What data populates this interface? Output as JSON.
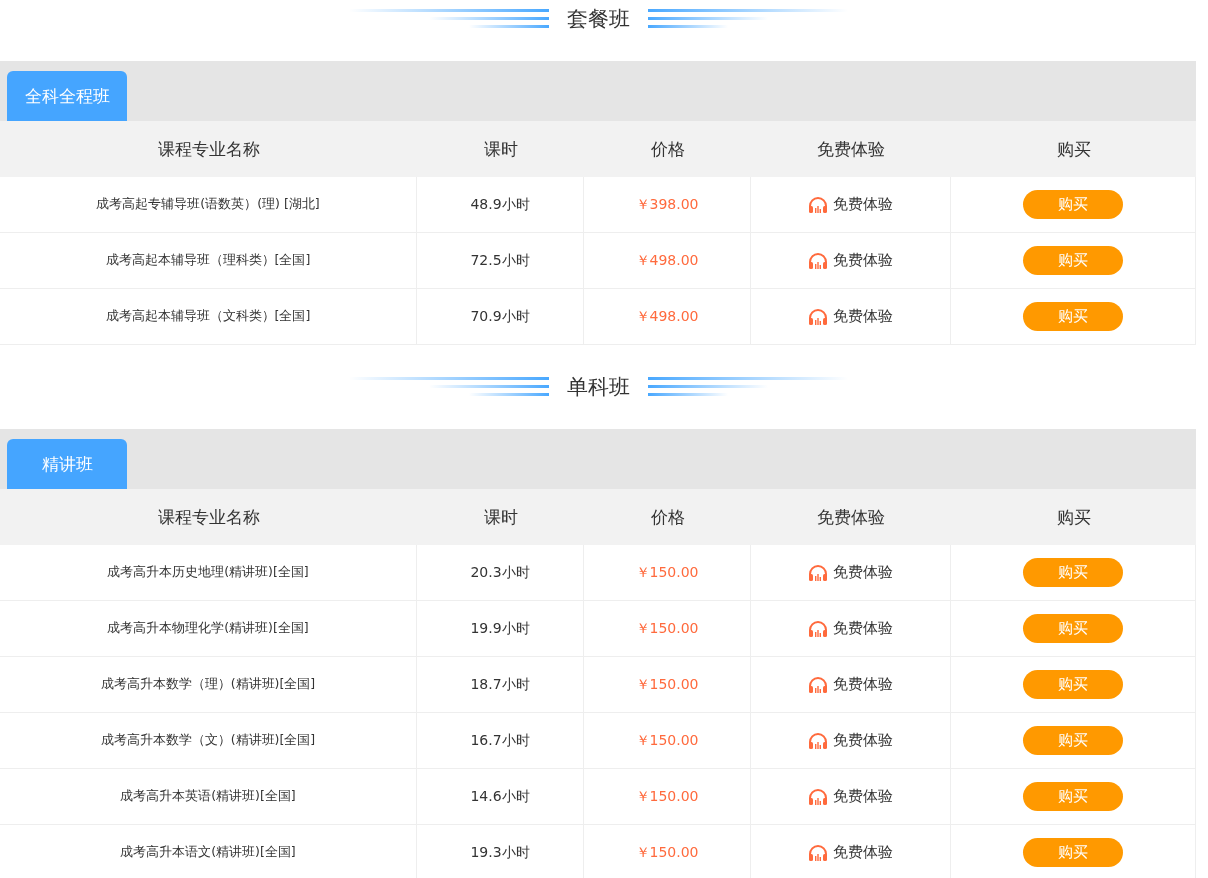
{
  "sections": [
    {
      "heading": "套餐班",
      "tabs": [
        {
          "label": "全科全程班",
          "selected": true
        }
      ],
      "columns": [
        "课程专业名称",
        "课时",
        "价格",
        "免费体验",
        "购买"
      ],
      "rows": [
        {
          "name": "成考高起专辅导班(语数英）(理) [湖北]",
          "hours": "48.9小时",
          "price": "￥398.00",
          "trial": "免费体验",
          "buy": "购买"
        },
        {
          "name": "成考高起本辅导班（理科类）[全国]",
          "hours": "72.5小时",
          "price": "￥498.00",
          "trial": "免费体验",
          "buy": "购买"
        },
        {
          "name": "成考高起本辅导班（文科类）[全国]",
          "hours": "70.9小时",
          "price": "￥498.00",
          "trial": "免费体验",
          "buy": "购买"
        }
      ]
    },
    {
      "heading": "单科班",
      "tabs": [
        {
          "label": "精讲班",
          "selected": true
        }
      ],
      "columns": [
        "课程专业名称",
        "课时",
        "价格",
        "免费体验",
        "购买"
      ],
      "rows": [
        {
          "name": "成考高升本历史地理(精讲班)[全国]",
          "hours": "20.3小时",
          "price": "￥150.00",
          "trial": "免费体验",
          "buy": "购买"
        },
        {
          "name": "成考高升本物理化学(精讲班)[全国]",
          "hours": "19.9小时",
          "price": "￥150.00",
          "trial": "免费体验",
          "buy": "购买"
        },
        {
          "name": "成考高升本数学（理）(精讲班)[全国]",
          "hours": "18.7小时",
          "price": "￥150.00",
          "trial": "免费体验",
          "buy": "购买"
        },
        {
          "name": "成考高升本数学（文）(精讲班)[全国]",
          "hours": "16.7小时",
          "price": "￥150.00",
          "trial": "免费体验",
          "buy": "购买"
        },
        {
          "name": "成考高升本英语(精讲班)[全国]",
          "hours": "14.6小时",
          "price": "￥150.00",
          "trial": "免费体验",
          "buy": "购买"
        },
        {
          "name": "成考高升本语文(精讲班)[全国]",
          "hours": "19.3小时",
          "price": "￥150.00",
          "trial": "免费体验",
          "buy": "购买"
        }
      ]
    }
  ]
}
